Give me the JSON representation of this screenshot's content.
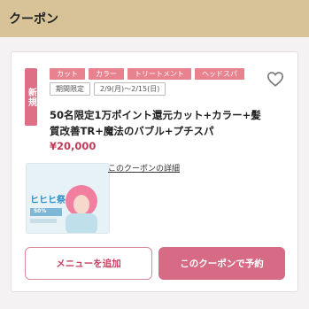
{
  "header": {
    "title": "クーポン"
  },
  "coupon": {
    "badge": "新規",
    "tags": [
      "カット",
      "カラー",
      "トリートメント",
      "ヘッドスパ"
    ],
    "period_label": "期間限定",
    "period_dates": "2/9(月)〜2/15(日)",
    "title": "50名限定1万ポイント還元カット+カラー+髪質改善TR+魔法のバブル+プチスパ",
    "price": "¥20,000",
    "detail_link": "このクーポンの詳細",
    "banner": {
      "headline": "ヒヒヒ祭",
      "sub": "50%"
    },
    "buttons": {
      "add_menu": "メニューを追加",
      "reserve": "このクーポンで予約"
    },
    "favorite_icon": "heart-icon"
  },
  "colors": {
    "header_bg": "#d8c398",
    "accent": "#de6f87",
    "price": "#c23a55"
  }
}
